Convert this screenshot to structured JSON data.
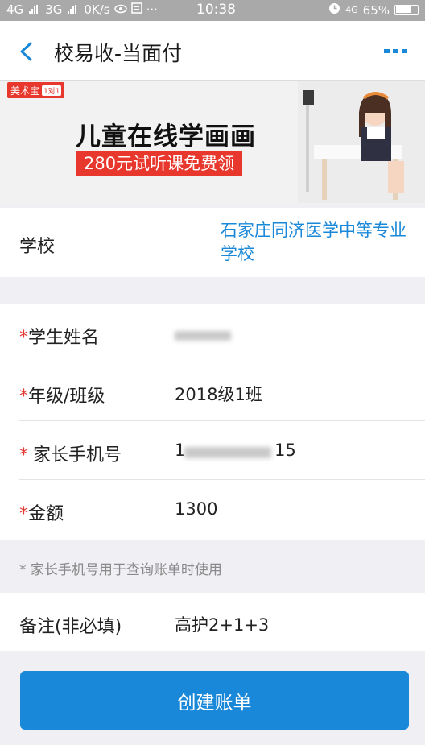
{
  "status_bar": {
    "left": "4G​  3G  0K/s",
    "net1": "4G",
    "net2": "3G",
    "speed": "0K/s",
    "time": "10:38",
    "network_right": "4G",
    "battery": "65%"
  },
  "nav": {
    "title": "校易收-当面付"
  },
  "banner": {
    "logo": "美术宝",
    "logo_tag": "1对1",
    "heading": "儿童在线学画画",
    "offer": "280元试听课免费领"
  },
  "school": {
    "label": "学校",
    "value": "石家庄同济医学中等专业学校"
  },
  "form": {
    "student_name": {
      "label": "学生姓名",
      "required_mark": "*",
      "value": ""
    },
    "grade_class": {
      "label": "年级/班级",
      "required_mark": "*",
      "value": "2018级1班"
    },
    "parent_phone": {
      "label": "家长手机号",
      "required_mark": "*",
      "value_prefix": "1",
      "value_suffix": "15"
    },
    "amount": {
      "label": "金额",
      "required_mark": "*",
      "value": "1300"
    }
  },
  "hint": {
    "mark": "*",
    "text": "家长手机号用于查询账单时使用"
  },
  "remark": {
    "label": "备注(非必填)",
    "value": "高护2+1+3"
  },
  "submit": {
    "label": "创建账单"
  },
  "colors": {
    "accent": "#1a88d8",
    "required": "#e53935",
    "banner_red": "#e8382e"
  }
}
